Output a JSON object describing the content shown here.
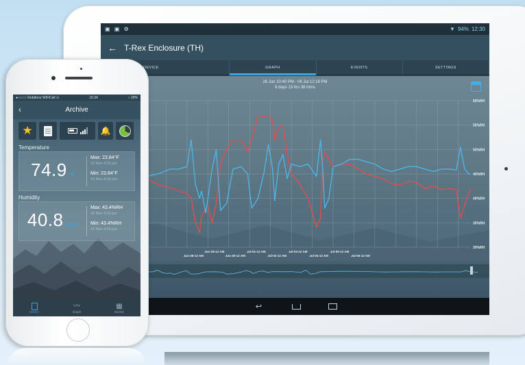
{
  "tablet": {
    "status": {
      "left_icons": "▣ ▣ ⚙",
      "wifi": "▼",
      "battery": "94%",
      "time": "12:30"
    },
    "title": "T-Rex Enclosure (TH)",
    "back_glyph": "←",
    "tabs": [
      "DEVICE",
      "GRAPH",
      "EVENTS",
      "SETTINGS"
    ],
    "active_tab": "GRAPH",
    "range_line1": "26 Jun 10:40 PM - 06 Jul 12:18 PM",
    "range_line2": "9 days 13 hrs 38 mins",
    "nav": {
      "back": "↩"
    }
  },
  "phone": {
    "status": {
      "carrier": "●○○○○ Vodafone WiFiCall ☷",
      "time": "16:34",
      "battery": "○ 20%"
    },
    "header_title": "Archive",
    "back_glyph": "‹",
    "icons": [
      "star-icon",
      "report-icon",
      "battery-icon",
      "signal-icon",
      "bell-icon",
      "pie-icon"
    ],
    "temperature": {
      "label": "Temperature",
      "value": "74.9",
      "unit": "°F",
      "max": "Max: 23.84°F",
      "max_time": "16 Nov 4:33 pm",
      "min": "Min: 23.84°F",
      "min_time": "16 Nov 4:33 pm"
    },
    "humidity": {
      "label": "Humidity",
      "value": "40.8",
      "unit": "%RH",
      "max": "Max: 43.4%RH",
      "max_time": "16 Nov 4:33 pm",
      "min": "Min: 43.4%RH",
      "min_time": "16 Nov 4:33 pm"
    },
    "tabbar": [
      "Device",
      "Graph",
      "Events"
    ]
  },
  "chart_data": {
    "type": "line",
    "y_right_ticks": [
      "60%RH",
      "55%RH",
      "50%RH",
      "45%RH",
      "40%RH",
      "35%RH",
      "30%RH"
    ],
    "ylim": [
      30,
      60
    ],
    "x_ticks_lower": [
      "Jun-28-12 AM",
      "Jun-30-12 AM",
      "Jul-02-12 AM",
      "Jul-04-12 AM",
      "Jul-06-12 AM"
    ],
    "x_ticks_upper": [
      "Jun-29-12 AM",
      "Jul-01-12 AM",
      "Jul-03-12 AM",
      "Jul-05-12 AM"
    ],
    "x_range_days": [
      1.55,
      9.3
    ],
    "series": [
      {
        "color": "#e64c4c",
        "x": [
          1.55,
          1.8,
          2.1,
          2.3,
          2.5,
          2.6,
          2.7,
          2.8,
          2.85,
          3.0,
          3.1,
          3.2,
          3.3,
          3.45,
          3.6,
          3.8,
          3.95,
          4.05,
          4.2,
          4.35,
          4.45,
          4.55,
          4.6,
          4.7,
          4.8,
          4.9,
          5.0,
          5.2,
          5.4,
          5.6,
          5.7,
          5.75,
          5.8,
          5.9,
          6.0,
          6.2,
          6.4,
          6.6,
          6.8,
          7.0,
          7.2,
          7.4,
          7.6,
          7.8,
          8.0,
          8.2,
          8.4,
          8.6,
          8.8,
          8.95,
          9.05,
          9.15,
          9.25,
          9.3
        ],
        "values": [
          44,
          42.8,
          42.2,
          41.5,
          41,
          40.2,
          35,
          33,
          36.5,
          38.5,
          35,
          39,
          47,
          50,
          52,
          52,
          49.5,
          52,
          57,
          56.8,
          57,
          56,
          52,
          54.5,
          55,
          49,
          45,
          43,
          40,
          34,
          36,
          47.5,
          49.5,
          48,
          46.5,
          47,
          47,
          46,
          45,
          44.5,
          44,
          43,
          42.7,
          43.5,
          43.3,
          42,
          42.5,
          41.8,
          42,
          41.8,
          36,
          38.5,
          41,
          42
        ]
      },
      {
        "color": "#4fb3e6",
        "x": [
          1.55,
          1.8,
          2.1,
          2.3,
          2.5,
          2.6,
          2.7,
          2.8,
          2.85,
          2.95,
          3.1,
          3.2,
          3.3,
          3.45,
          3.6,
          3.8,
          3.95,
          4.05,
          4.2,
          4.35,
          4.45,
          4.55,
          4.6,
          4.7,
          4.8,
          4.9,
          5.0,
          5.2,
          5.4,
          5.6,
          5.7,
          5.75,
          5.8,
          5.9,
          6.0,
          6.2,
          6.4,
          6.6,
          6.8,
          7.0,
          7.2,
          7.4,
          7.6,
          7.8,
          8.0,
          8.2,
          8.4,
          8.6,
          8.8,
          8.95,
          9.05,
          9.15,
          9.25,
          9.3
        ],
        "values": [
          44.5,
          45,
          46,
          46,
          46.5,
          52,
          43,
          40,
          41.5,
          37,
          46,
          50,
          37.5,
          39,
          46,
          46.5,
          45,
          38,
          40,
          45.5,
          51,
          46,
          39.5,
          47,
          49,
          44,
          47,
          46.5,
          47,
          44.5,
          52,
          46,
          38,
          40,
          46.5,
          47,
          48,
          48,
          47.5,
          47,
          46,
          45.5,
          46,
          46.5,
          46.5,
          46,
          45.5,
          46,
          46,
          45.8,
          50.5,
          46,
          45,
          45
        ]
      }
    ]
  }
}
